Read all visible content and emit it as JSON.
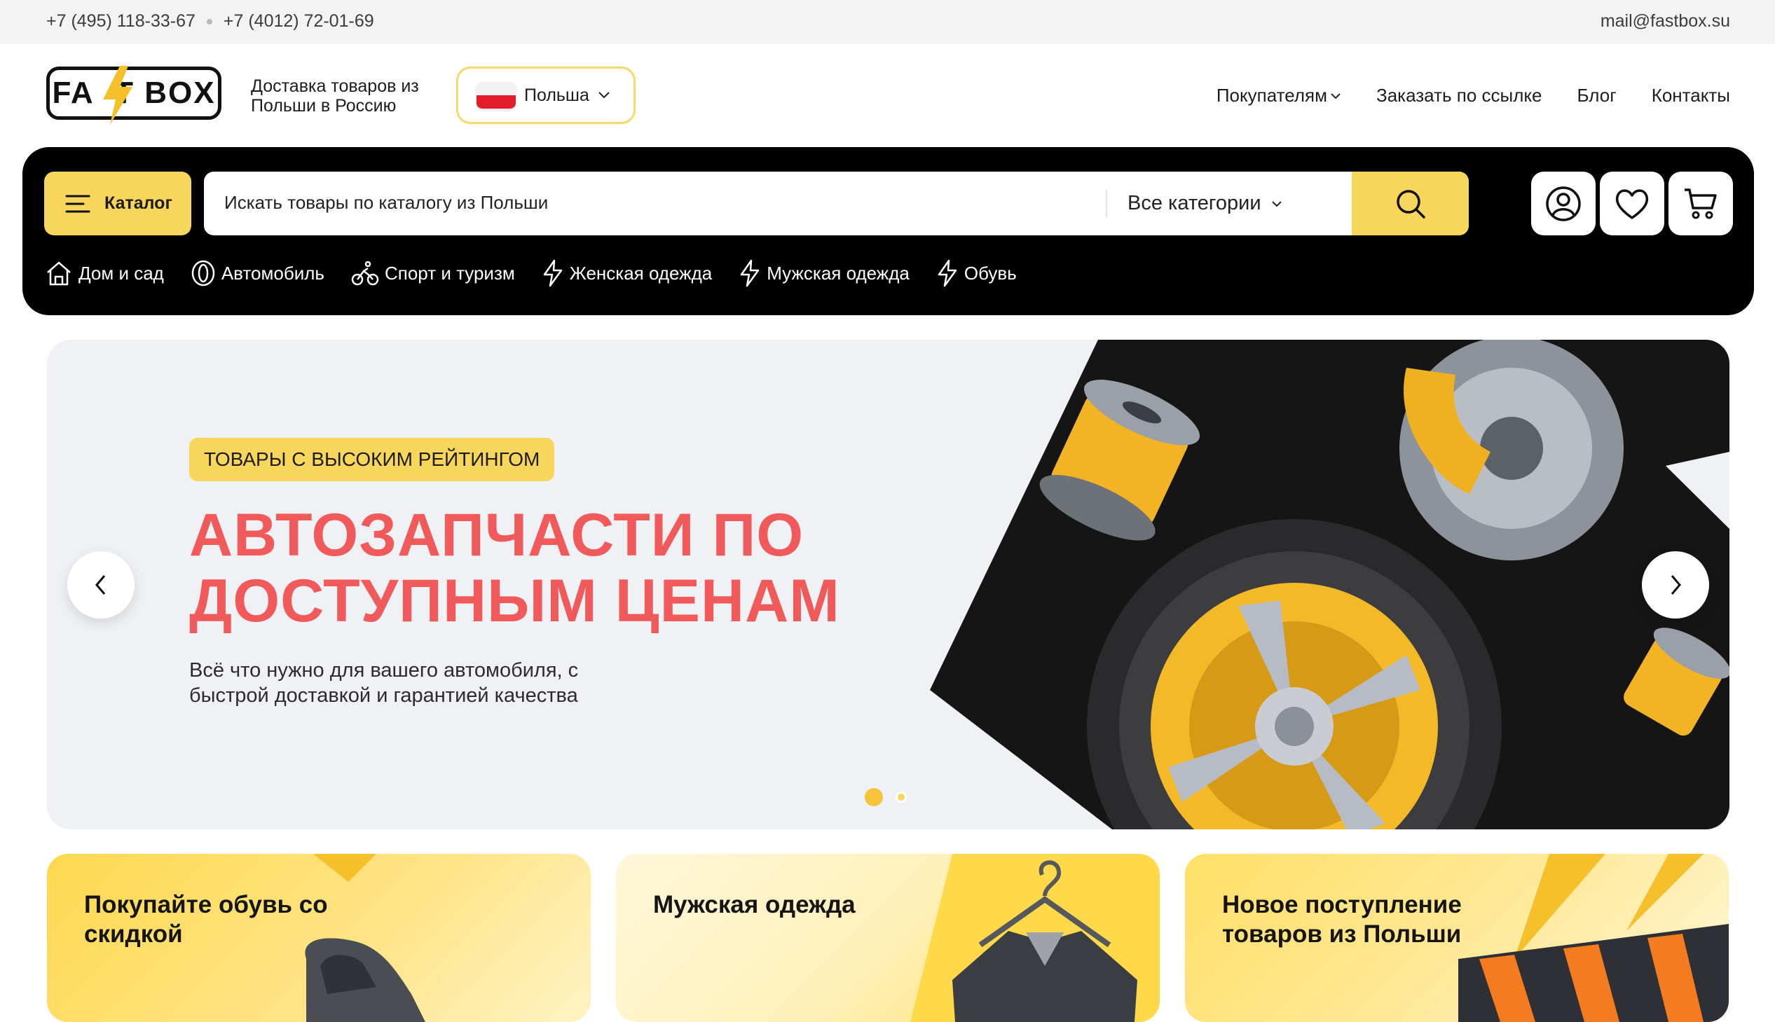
{
  "topbar": {
    "phone1": "+7 (495) 118-33-67",
    "phone2": "+7 (4012) 72-01-69",
    "email": "mail@fastbox.su"
  },
  "header": {
    "logo_text": "FA T BOX",
    "tagline": "Доставка товаров из Польши в Россию",
    "country": "Польша",
    "nav": [
      {
        "label": "Покупателям",
        "has_dropdown": true
      },
      {
        "label": "Заказать по ссылке"
      },
      {
        "label": "Блог"
      },
      {
        "label": "Контакты"
      }
    ]
  },
  "search": {
    "catalog_label": "Каталог",
    "placeholder": "Искать товары по каталогу из Польши",
    "category_select": "Все категории"
  },
  "categories": [
    {
      "label": "Дом и сад",
      "icon": "house-icon"
    },
    {
      "label": "Автомобиль",
      "icon": "tire-icon"
    },
    {
      "label": "Спорт и туризм",
      "icon": "bicycle-icon"
    },
    {
      "label": "Женская одежда",
      "icon": "lightning-icon"
    },
    {
      "label": "Мужская одежда",
      "icon": "lightning-icon"
    },
    {
      "label": "Обувь",
      "icon": "lightning-icon"
    }
  ],
  "hero": {
    "badge": "ТОВАРЫ С ВЫСОКИМ РЕЙТИНГОМ",
    "title": "АВТОЗАПЧАСТИ ПО ДОСТУПНЫМ ЦЕНАМ",
    "subtitle": "Всё что нужно для вашего автомобиля, с быстрой доставкой и гарантией качества",
    "slide_index": 1,
    "slide_count": 2
  },
  "promo_cards": [
    {
      "title": "Покупайте обувь со скидкой"
    },
    {
      "title": "Мужская одежда"
    },
    {
      "title": "Новое поступление товаров из Польши"
    }
  ],
  "colors": {
    "accent": "#f8d55b",
    "headline": "#f15a5a",
    "dark": "#000000"
  }
}
